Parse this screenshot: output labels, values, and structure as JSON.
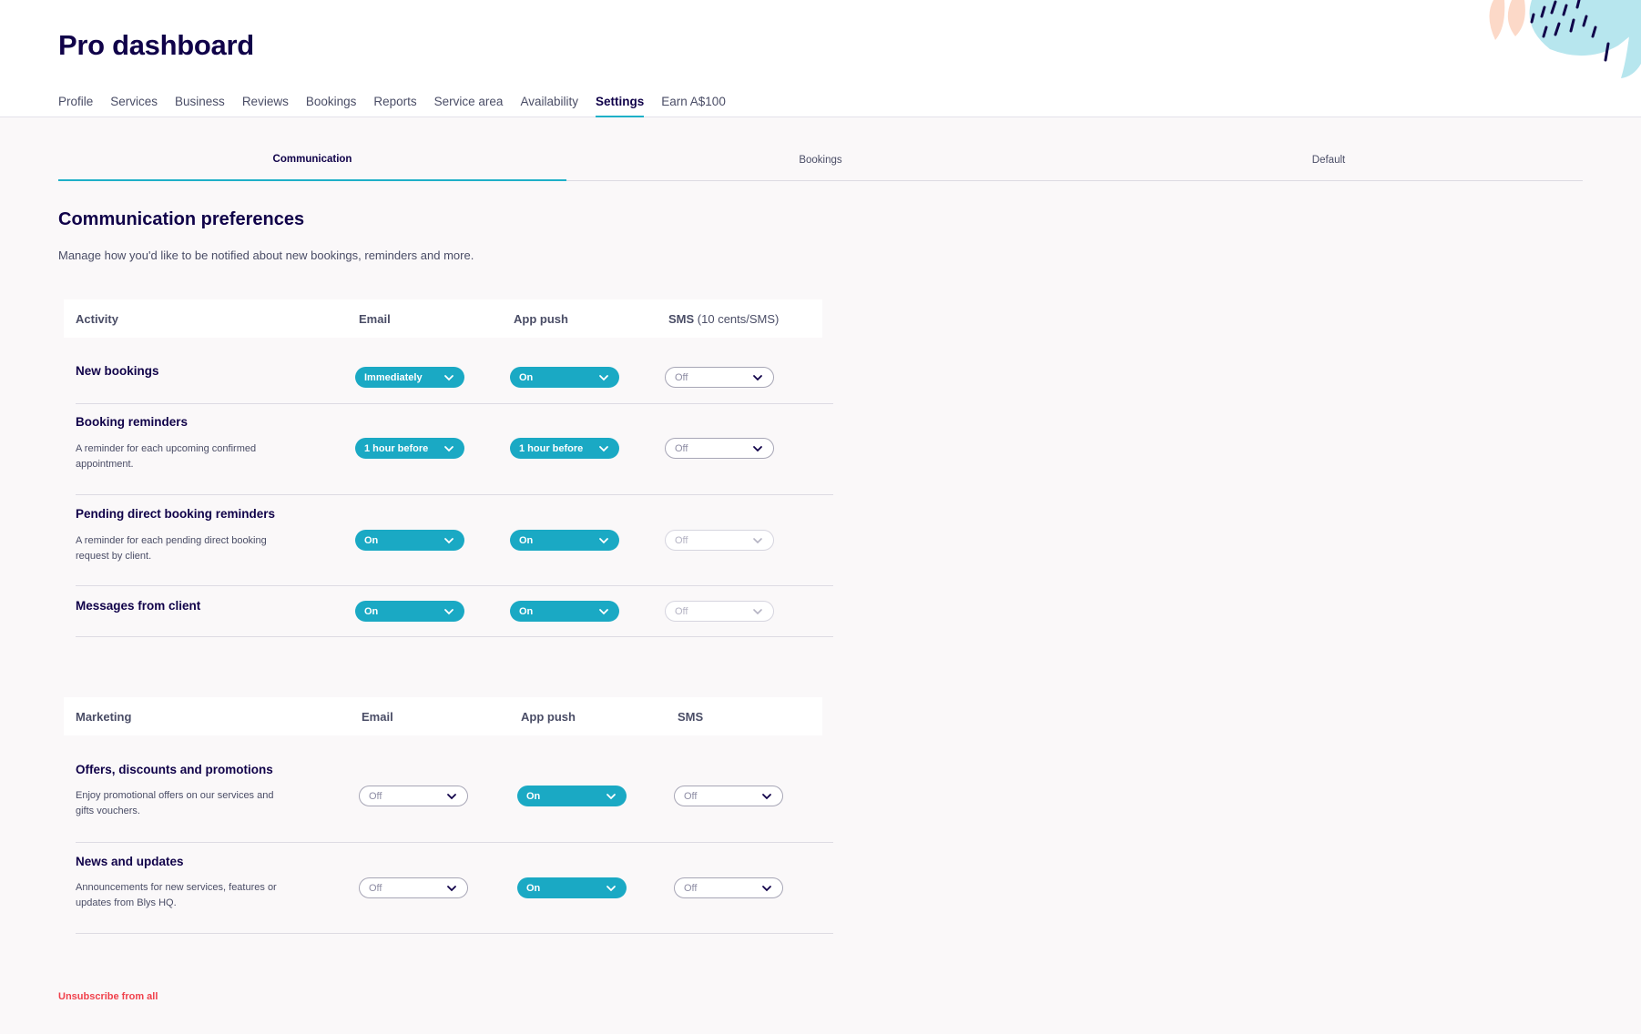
{
  "page_title": "Pro dashboard",
  "nav": [
    {
      "label": "Profile"
    },
    {
      "label": "Services"
    },
    {
      "label": "Business"
    },
    {
      "label": "Reviews"
    },
    {
      "label": "Bookings"
    },
    {
      "label": "Reports"
    },
    {
      "label": "Service area"
    },
    {
      "label": "Availability"
    },
    {
      "label": "Settings"
    },
    {
      "label": "Earn A$100"
    }
  ],
  "subtabs": [
    {
      "label": "Communication"
    },
    {
      "label": "Bookings"
    },
    {
      "label": "Default"
    }
  ],
  "section": {
    "title": "Communication preferences",
    "description": "Manage how you'd like to be notified about new bookings, reminders and more."
  },
  "activity": {
    "headers": {
      "activity": "Activity",
      "email": "Email",
      "app_push": "App push",
      "sms": "SMS",
      "sms_note": "(10 cents/SMS)"
    },
    "rows": [
      {
        "title": "New bookings",
        "description": "",
        "email": "Immediately",
        "app_push": "On",
        "sms": "Off"
      },
      {
        "title": "Booking reminders",
        "description": "A reminder for each upcoming confirmed appointment.",
        "email": "1 hour before",
        "app_push": "1 hour before",
        "sms": "Off"
      },
      {
        "title": "Pending direct booking reminders",
        "description": "A reminder for each pending direct booking request by client.",
        "email": "On",
        "app_push": "On",
        "sms": "Off"
      },
      {
        "title": "Messages from client",
        "description": "",
        "email": "On",
        "app_push": "On",
        "sms": "Off"
      }
    ]
  },
  "marketing": {
    "headers": {
      "marketing": "Marketing",
      "email": "Email",
      "app_push": "App push",
      "sms": "SMS"
    },
    "rows": [
      {
        "title": "Offers, discounts and promotions",
        "description": "Enjoy promotional offers on our services and gifts vouchers.",
        "email": "Off",
        "app_push": "On",
        "sms": "Off"
      },
      {
        "title": "News and updates",
        "description": "Announcements for new services, features or updates from Blys HQ.",
        "email": "Off",
        "app_push": "On",
        "sms": "Off"
      }
    ]
  },
  "unsubscribe_label": "Unsubscribe from all",
  "colors": {
    "accent": "#1aa9c4",
    "navy": "#100249",
    "danger": "#f0414c"
  }
}
